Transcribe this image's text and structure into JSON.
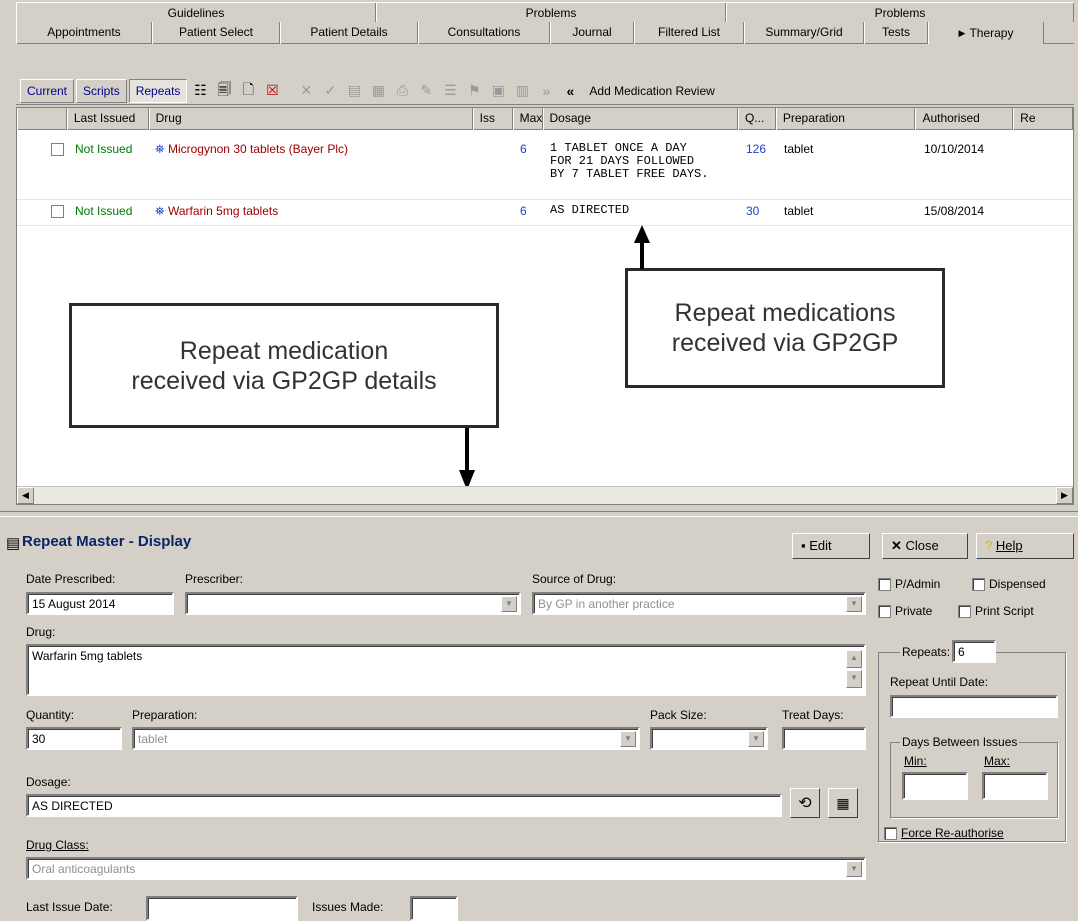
{
  "tabs_top": [
    "Guidelines",
    "Problems",
    "Problems"
  ],
  "tabs_main": [
    "Appointments",
    "Patient Select",
    "Patient Details",
    "Consultations",
    "Journal",
    "Filtered List",
    "Summary/Grid",
    "Tests",
    "Therapy"
  ],
  "toolbar": {
    "current": "Current",
    "scripts": "Scripts",
    "repeats": "Repeats",
    "add_review": "Add Medication Review",
    "more": "»",
    "back": "«"
  },
  "grid": {
    "columns": [
      "Last Issued",
      "Drug",
      "Iss",
      "Max",
      "Dosage",
      "Q...",
      "Preparation",
      "Authorised",
      "Re"
    ],
    "rows": [
      {
        "last_issued": "Not Issued",
        "drug": "Microgynon 30 tablets (Bayer Plc)",
        "iss": "",
        "max": "6",
        "dosage_line1": "1 TABLET ONCE A DAY",
        "dosage_line2": "FOR 21 DAYS FOLLOWED",
        "dosage_line3": "BY 7 TABLET FREE DAYS.",
        "qty": "126",
        "preparation": "tablet",
        "authorised": "10/10/2014"
      },
      {
        "last_issued": "Not Issued",
        "drug": "Warfarin 5mg tablets",
        "iss": "",
        "max": "6",
        "dosage_line1": "AS DIRECTED",
        "qty": "30",
        "preparation": "tablet",
        "authorised": "15/08/2014"
      }
    ]
  },
  "callouts": {
    "left_line1": "Repeat medication",
    "left_line2": "received via GP2GP details",
    "right_line1": "Repeat medications",
    "right_line2": "received via GP2GP"
  },
  "panel": {
    "title": "Repeat Master - Display",
    "edit": "Edit",
    "close": "Close",
    "help": "Help",
    "date_prescribed_label": "Date Prescribed:",
    "date_prescribed": "15 August 2014",
    "prescriber_label": "Prescriber:",
    "prescriber": "",
    "source_label": "Source of Drug:",
    "source": "By GP in another practice",
    "padmin": "P/Admin",
    "dispensed": "Dispensed",
    "private": "Private",
    "print_script": "Print Script",
    "drug_label": "Drug:",
    "drug": "Warfarin 5mg tablets",
    "repeats_label": "Repeats:",
    "repeats": "6",
    "repeat_until_label": "Repeat Until Date:",
    "repeat_until": "",
    "quantity_label": "Quantity:",
    "quantity": "30",
    "preparation_label": "Preparation:",
    "preparation": "tablet",
    "pack_size_label": "Pack Size:",
    "treat_days_label": "Treat Days:",
    "days_between_label": "Days Between Issues",
    "min_label": "Min:",
    "max_label": "Max:",
    "dosage_label": "Dosage:",
    "dosage": "AS DIRECTED",
    "force_reauth": "Force Re-authorise",
    "drug_class_label": "Drug Class:",
    "drug_class": "Oral anticoagulants",
    "last_issue_label": "Last Issue Date:",
    "issues_made_label": "Issues Made:"
  }
}
